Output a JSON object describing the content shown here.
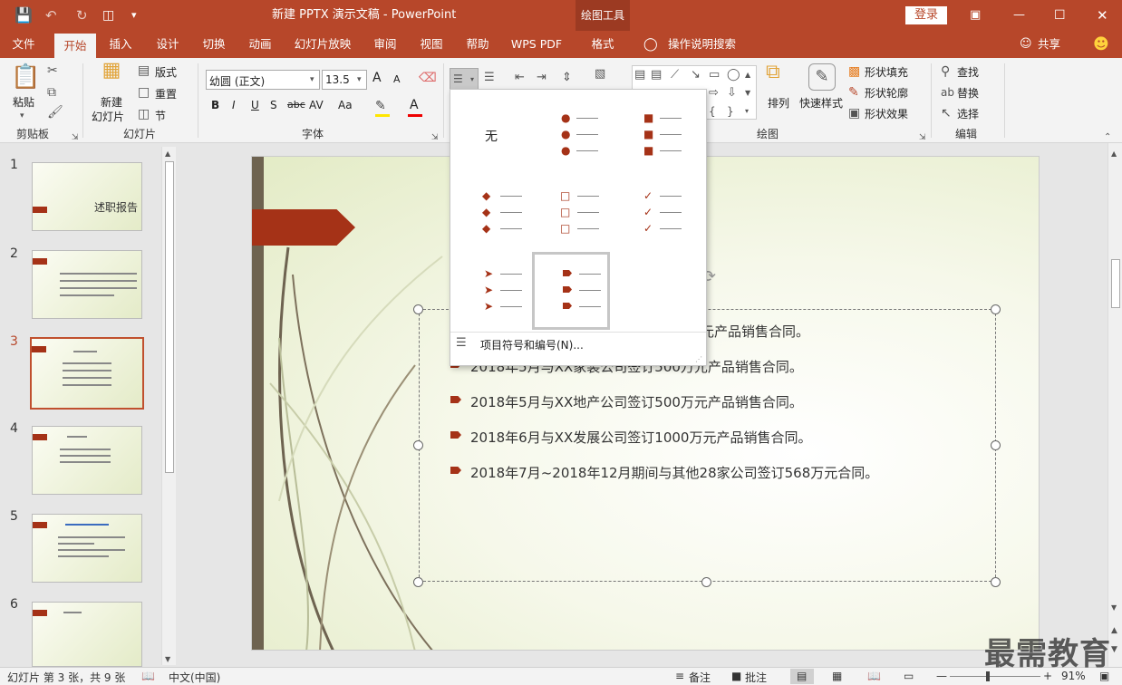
{
  "titlebar": {
    "document_title": "新建 PPTX 演示文稿  -  PowerPoint",
    "context_header": "绘图工具",
    "login_label": "登录"
  },
  "tabs": [
    "文件",
    "开始",
    "插入",
    "设计",
    "切换",
    "动画",
    "幻灯片放映",
    "审阅",
    "视图",
    "帮助",
    "WPS PDF",
    "格式"
  ],
  "tell_me": "操作说明搜索",
  "share": "共享",
  "ribbon": {
    "clipboard": {
      "paste": "粘贴",
      "label": "剪贴板"
    },
    "slides": {
      "new_slide_line1": "新建",
      "new_slide_line2": "幻灯片",
      "layout": "版式",
      "reset": "重置",
      "section": "节",
      "label": "幻灯片"
    },
    "font": {
      "name": "幼圆 (正文)",
      "size": "13.5",
      "label": "字体",
      "bold": "B",
      "italic": "I",
      "underline": "U",
      "shadow": "S",
      "strike": "abc",
      "spacing": "AV",
      "case": "Aa",
      "grow": "A",
      "shrink": "A"
    },
    "drawing": {
      "arrange": "排列",
      "quick_styles": "快速样式",
      "shape_fill": "形状填充",
      "shape_outline": "形状轮廓",
      "shape_effects": "形状效果",
      "label": "绘图"
    },
    "editing": {
      "find": "查找",
      "replace": "替换",
      "select": "选择",
      "label": "编辑"
    }
  },
  "dropdown": {
    "none_label": "无",
    "footer_label": "项目符号和编号(N)..."
  },
  "slide_numbers": [
    "1",
    "2",
    "3",
    "4",
    "5",
    "6"
  ],
  "thumb_titles": [
    "述职报告"
  ],
  "slide": {
    "bullets": [
      "2018年3月与XX广告公司签订500万元产品销售合同。",
      "2018年5月与XX家装公司签订500万元产品销售合同。",
      "2018年5月与XX地产公司签订500万元产品销售合同。",
      "2018年6月与XX发展公司签订1000万元产品销售合同。",
      "2018年7月~2018年12月期间与其他28家公司签订568万元合同。"
    ],
    "visible_partial": [
      "元产品销售合同。",
      "2018年5月与XX家装公司签订500万元产品销售合同。"
    ]
  },
  "statusbar": {
    "slide_info": "幻灯片 第 3 张，共 9 张",
    "language": "中文(中国)",
    "notes": "备注",
    "comments": "批注",
    "zoom": "91%"
  },
  "watermark": "最需教育",
  "colors": {
    "accent": "#b7472a",
    "bullet": "#a53217"
  }
}
